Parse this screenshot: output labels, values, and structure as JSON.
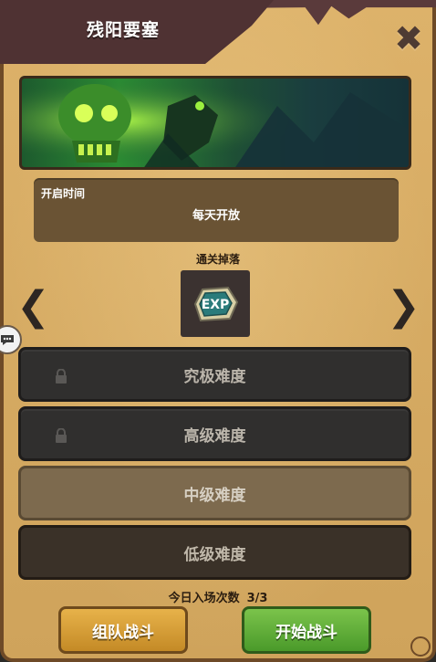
{
  "header": {
    "title": "残阳要塞",
    "close_icon": "close-icon"
  },
  "open_time": {
    "label": "开启时间",
    "value": "每天开放"
  },
  "drops": {
    "label": "通关掉落",
    "item_text": "EXP"
  },
  "difficulties": [
    {
      "label": "究极难度",
      "locked": true
    },
    {
      "label": "高级难度",
      "locked": true
    },
    {
      "label": "中级难度",
      "locked": false
    },
    {
      "label": "低级难度",
      "locked": false
    }
  ],
  "entries": {
    "label": "今日入场次数",
    "count": "3/3"
  },
  "buttons": {
    "team_battle": "组队战斗",
    "start_battle": "开始战斗"
  },
  "colors": {
    "panel": "#dcb067",
    "ribbon": "#5a3a3b",
    "team_button": "#e7b24a",
    "start_button": "#7bc34b"
  }
}
